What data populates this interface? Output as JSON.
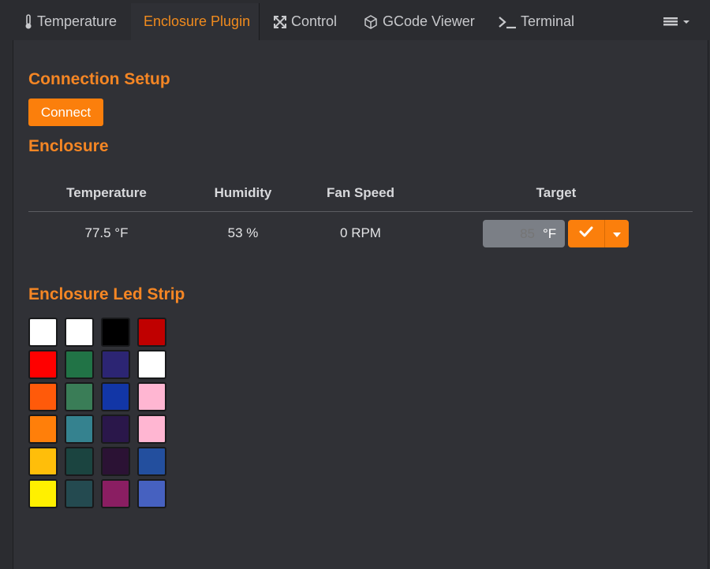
{
  "tabs": [
    {
      "label": "Temperature",
      "icon": "thermometer-icon"
    },
    {
      "label": "Enclosure Plugin",
      "icon": ""
    },
    {
      "label": "Control",
      "icon": "arrows-expand-icon"
    },
    {
      "label": "GCode Viewer",
      "icon": "cube-icon"
    },
    {
      "label": "Terminal",
      "icon": "terminal-icon"
    }
  ],
  "active_tab": "Enclosure Plugin",
  "connection": {
    "title": "Connection Setup",
    "connect_label": "Connect"
  },
  "enclosure": {
    "title": "Enclosure",
    "headers": {
      "temperature": "Temperature",
      "humidity": "Humidity",
      "fan_speed": "Fan Speed",
      "target": "Target"
    },
    "values": {
      "temperature": "77.5 °F",
      "humidity": "53 %",
      "fan_speed": "0 RPM"
    },
    "target": {
      "placeholder": "85",
      "unit": "°F"
    }
  },
  "led": {
    "title": "Enclosure Led Strip",
    "colors": [
      "#ffffff",
      "#ffffff",
      "#000000",
      "#c00000",
      "#ff0000",
      "#217346",
      "#2c2573",
      "#ffffff",
      "#ff5a0a",
      "#3a7d57",
      "#1236a6",
      "#ffb6d2",
      "#ff7f0a",
      "#35828f",
      "#2a174a",
      "#ffb6d2",
      "#ffbe0a",
      "#1b4440",
      "#2b1234",
      "#234f9e",
      "#fff000",
      "#244a50",
      "#8a1e62",
      "#4661c0"
    ]
  },
  "accent": "#fb7f0c"
}
